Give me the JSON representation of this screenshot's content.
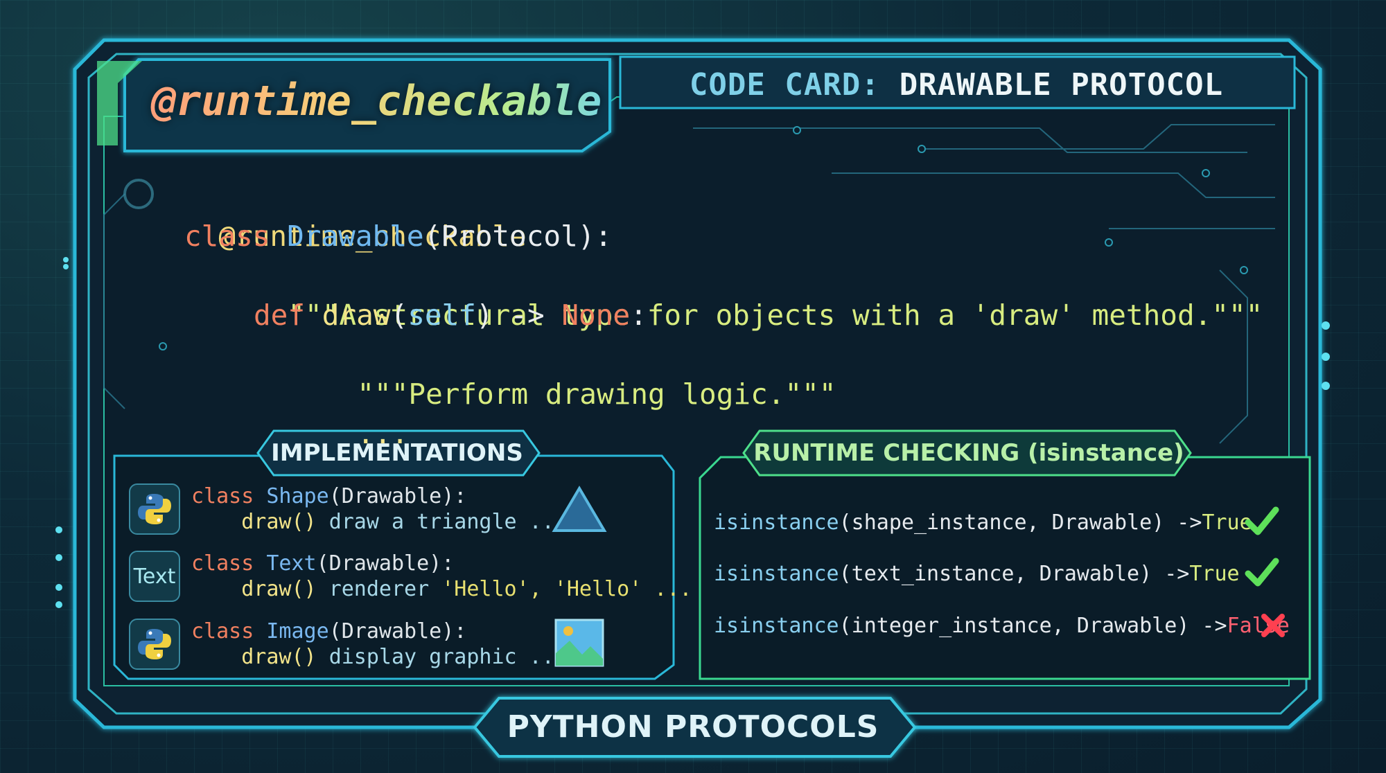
{
  "title_tab": "@runtime_checkable",
  "card_title": {
    "label": "CODE CARD:",
    "value": "DRAWABLE PROTOCOL"
  },
  "code": {
    "line1": "@runtime_checkable",
    "line2_kw": "class",
    "line2_cls": "Drawable",
    "line2_rest": "(Protocol):",
    "line3": "\"\"\"A structural type for objects with a 'draw' method.\"\"\"",
    "line4_kw": "def",
    "line4_fn": "draw",
    "line4_open": "(",
    "line4_self": "self",
    "line4_mid": ") ->",
    "line4_none": "None",
    "line4_end": ":",
    "line5": "\"\"\"Perform drawing logic.\"\"\"",
    "line6": "..."
  },
  "implementations": {
    "label": "IMPLEMENTATIONS",
    "items": [
      {
        "icon": "python-logo-icon",
        "kw": "class",
        "cls": "Shape",
        "rest": "(Drawable):",
        "fn": "draw()",
        "desc": "draw a triangle ...",
        "glyph": "triangle-icon"
      },
      {
        "icon": "text-icon",
        "icon_text": "Text",
        "kw": "class",
        "cls": "Text",
        "rest": "(Drawable):",
        "fn": "draw()",
        "desc": "renderer",
        "str": "'Hello', 'Hello' ..."
      },
      {
        "icon": "python-logo-icon",
        "kw": "class",
        "cls": "Image",
        "rest": "(Drawable):",
        "fn": "draw()",
        "desc": "display graphic ...",
        "glyph": "image-icon"
      }
    ]
  },
  "runtime": {
    "label": "RUNTIME CHECKING (isinstance)",
    "checks": [
      {
        "fn": "isinstance",
        "args": "(shape_instance, Drawable) ->",
        "result": "True",
        "status": "pass"
      },
      {
        "fn": "isinstance",
        "args": "(text_instance, Drawable) ->",
        "result": "True",
        "status": "pass"
      },
      {
        "fn": "isinstance",
        "args": "(integer_instance, Drawable) ->",
        "result": "False",
        "status": "fail"
      }
    ]
  },
  "footer": "PYTHON PROTOCOLS",
  "colors": {
    "accent": "#3fd6e0",
    "green": "#4ee08a",
    "true": "#5ee05a",
    "false": "#ff4050"
  }
}
